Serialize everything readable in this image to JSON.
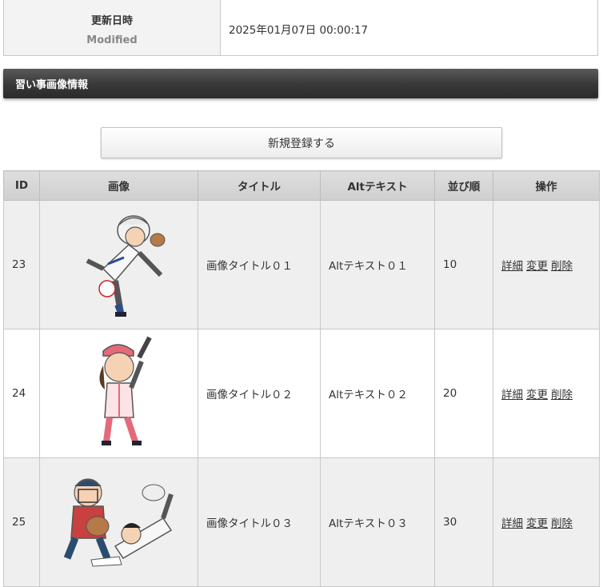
{
  "meta": {
    "label_jp": "更新日時",
    "label_en": "Modified",
    "value": "2025年01月07日 00:00:17"
  },
  "section": {
    "title": "習い事画像情報"
  },
  "register_button": "新規登録する",
  "table": {
    "headers": [
      "ID",
      "画像",
      "タイトル",
      "Altテキスト",
      "並び順",
      "操作"
    ],
    "rows": [
      {
        "id": "23",
        "image": "baseball-pitcher-illustration",
        "title": "画像タイトル０１",
        "alt": "Altテキスト０１",
        "order": "10",
        "ops": [
          "詳細",
          "変更",
          "削除"
        ]
      },
      {
        "id": "24",
        "image": "baseball-batter-girl-illustration",
        "title": "画像タイトル０２",
        "alt": "Altテキスト０２",
        "order": "20",
        "ops": [
          "詳細",
          "変更",
          "削除"
        ]
      },
      {
        "id": "25",
        "image": "baseball-catcher-slide-illustration",
        "title": "画像タイトル０３",
        "alt": "Altテキスト０３",
        "order": "30",
        "ops": [
          "詳細",
          "変更",
          "削除"
        ]
      }
    ]
  }
}
